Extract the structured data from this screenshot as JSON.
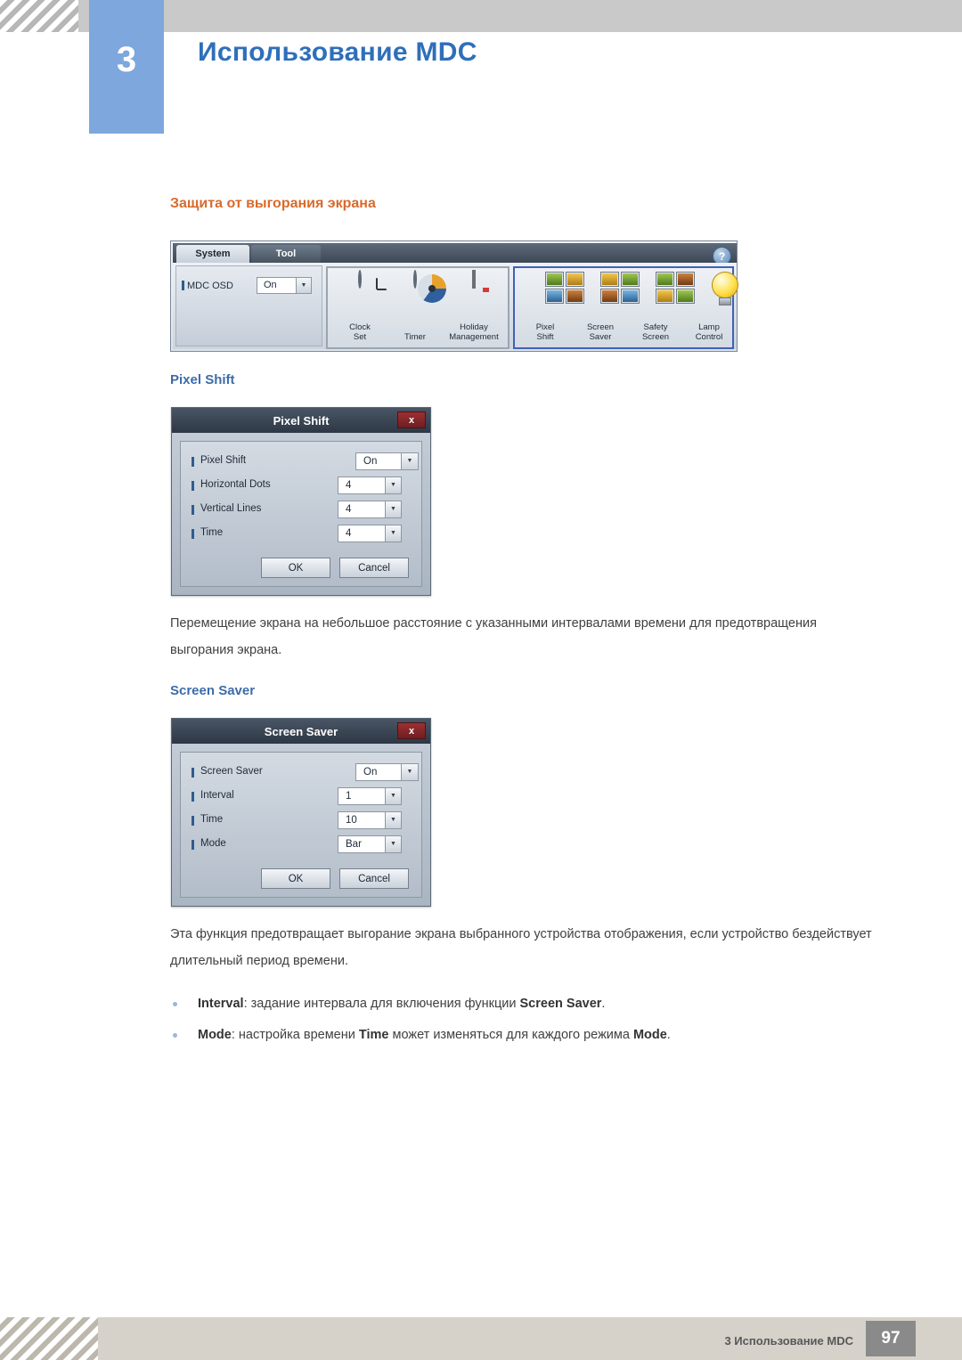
{
  "header": {
    "chapter_number": "3",
    "title": "Использование MDC"
  },
  "section": {
    "title": "Защита от выгорания экрана"
  },
  "mdc_toolbar": {
    "tabs": [
      {
        "label": "System",
        "active": true
      },
      {
        "label": "Tool",
        "active": false
      }
    ],
    "help_label": "?",
    "osd": {
      "label": "MDC OSD",
      "value": "On",
      "arrow": "▼"
    },
    "buttons": [
      {
        "icon": "clock-icon",
        "line1": "Clock",
        "line2": "Set"
      },
      {
        "icon": "timer-icon",
        "line1": "Timer",
        "line2": ""
      },
      {
        "icon": "calendar-icon",
        "line1": "Holiday",
        "line2": "Management"
      },
      {
        "icon": "pixel-shift-icon",
        "line1": "Pixel",
        "line2": "Shift"
      },
      {
        "icon": "screen-saver-icon",
        "line1": "Screen",
        "line2": "Saver"
      },
      {
        "icon": "safety-screen-icon",
        "line1": "Safety",
        "line2": "Screen"
      },
      {
        "icon": "lamp-icon",
        "line1": "Lamp",
        "line2": "Control"
      }
    ]
  },
  "pixel_shift": {
    "heading": "Pixel Shift",
    "dialog": {
      "title": "Pixel Shift",
      "close_label": "x",
      "rows": [
        {
          "label": "Pixel Shift",
          "value": "On",
          "arrow": "▼"
        },
        {
          "label": "Horizontal Dots",
          "value": "4",
          "arrow": "▼"
        },
        {
          "label": "Vertical Lines",
          "value": "4",
          "arrow": "▼"
        },
        {
          "label": "Time",
          "value": "4",
          "arrow": "▼"
        }
      ],
      "ok_label": "OK",
      "cancel_label": "Cancel"
    },
    "description": "Перемещение экрана на небольшое расстояние с указанными интервалами времени для предотвращения выгорания экрана."
  },
  "screen_saver": {
    "heading": "Screen Saver",
    "dialog": {
      "title": "Screen Saver",
      "close_label": "x",
      "rows": [
        {
          "label": "Screen Saver",
          "value": "On",
          "arrow": "▼"
        },
        {
          "label": "Interval",
          "value": "1",
          "arrow": "▼"
        },
        {
          "label": "Time",
          "value": "10",
          "arrow": "▼"
        },
        {
          "label": "Mode",
          "value": "Bar",
          "arrow": "▼"
        }
      ],
      "ok_label": "OK",
      "cancel_label": "Cancel"
    },
    "description": "Эта функция предотвращает выгорание экрана выбранного устройства отображения, если устройство бездействует длительный период времени.",
    "bullets": [
      {
        "b1": "Interval",
        "t1": ": задание интервала для включения функции ",
        "b2": "Screen Saver",
        "t2": "."
      },
      {
        "b1": "Mode",
        "t1": ": настройка времени ",
        "b2": "Time",
        "t2": " может изменяться для каждого режима ",
        "b3": "Mode",
        "t3": "."
      }
    ]
  },
  "footer": {
    "text": "3 Использование MDC",
    "page": "97"
  }
}
